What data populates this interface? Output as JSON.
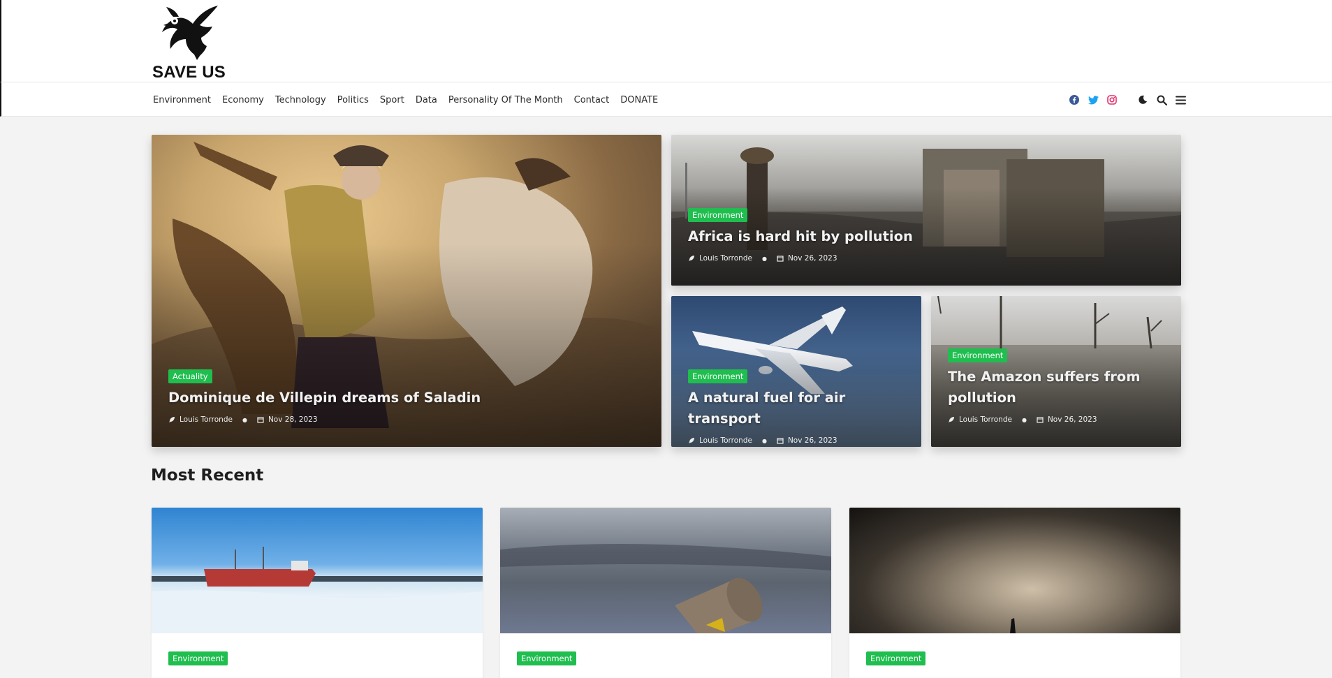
{
  "site": {
    "logo_text": "SAVE US"
  },
  "nav": {
    "links": [
      "Environment",
      "Economy",
      "Technology",
      "Politics",
      "Sport",
      "Data",
      "Personality Of The Month",
      "Contact",
      "DONATE"
    ],
    "icons": [
      "facebook-icon",
      "twitter-icon",
      "instagram-icon",
      "dark-mode-icon",
      "search-icon",
      "menu-icon"
    ]
  },
  "colors": {
    "accent": "#1fbe4f",
    "facebook": "#3b5998",
    "twitter": "#1da1f2",
    "instagram": "#e1306c"
  },
  "hero": [
    {
      "category": "Actuality",
      "title": "Dominique de Villepin dreams of Saladin",
      "author": "Louis Torronde",
      "date": "Nov 28, 2023"
    },
    {
      "category": "Environment",
      "title": "Africa is hard hit by pollution",
      "author": "Louis Torronde",
      "date": "Nov 26, 2023"
    },
    {
      "category": "Environment",
      "title": "A natural fuel for air transport",
      "author": "Louis Torronde",
      "date": "Nov 26, 2023"
    },
    {
      "category": "Environment",
      "title": "The Amazon suffers from pollution",
      "author": "Louis Torronde",
      "date": "Nov 26, 2023"
    }
  ],
  "recent": {
    "heading": "Most Recent",
    "cards": [
      {
        "category": "Environment"
      },
      {
        "category": "Environment"
      },
      {
        "category": "Environment"
      }
    ]
  }
}
